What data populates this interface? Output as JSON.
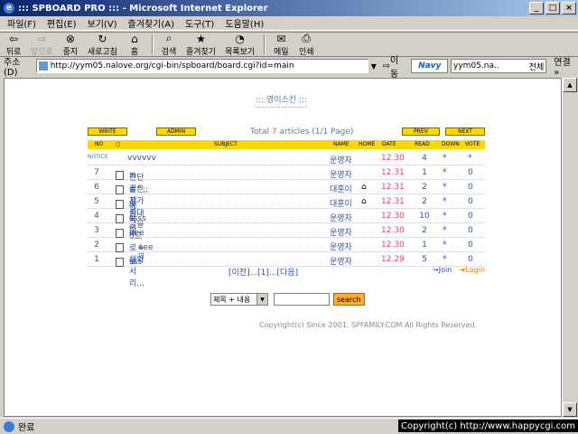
{
  "window": {
    "title": "::: SPBOARD PRO ::: - Microsoft Internet Explorer"
  },
  "menu": [
    "파일(F)",
    "편집(E)",
    "보기(V)",
    "즐겨찾기(A)",
    "도구(T)",
    "도움말(H)"
  ],
  "toolbar": {
    "back": "뒤로",
    "forward": "앞으로",
    "stop": "중지",
    "refresh": "새로고침",
    "home": "홈",
    "search": "검색",
    "favorites": "즐겨찾기",
    "history": "목록보기",
    "mail": "메일",
    "print": "인쇄"
  },
  "address": {
    "label": "주소(D)",
    "url": "http://yym05.nalove.org/cgi-bin/spboard/board.cgi?id=main",
    "go": "이동",
    "search_value": "yym05.na..",
    "search_scope": "전체",
    "links": "연결 »"
  },
  "board": {
    "title": "::: 영이스킨 :::",
    "buttons": {
      "write": "WRITE",
      "admin": "ADMIN",
      "prev": "PREV",
      "next": "NEXT"
    },
    "total_prefix": "Total ",
    "total_num": "7",
    "total_suffix": " articles (1/1 Page)",
    "headers": {
      "no": "NO",
      "subject": "SUBJECT",
      "name": "NAME",
      "home": "HOME",
      "date": "DATE",
      "read": "READ",
      "down": "DOWN",
      "vote": "VOTE"
    },
    "notice": {
      "no": "NOTICE",
      "subject": "vvvvvv",
      "name": "운영자",
      "date": "12.30",
      "read": "4",
      "down": "*",
      "vote": "*"
    },
    "rows": [
      {
        "no": "7",
        "subject": "간단글은 제가 최대글을 0으로 해와서리...",
        "name": "운영자",
        "home": "",
        "date": "12.31",
        "read": "1",
        "down": "*",
        "vote": "0"
      },
      {
        "no": "6",
        "subject": "^^;; 지송..",
        "name": "대훈이",
        "home": "⌂",
        "date": "12.31",
        "read": "2",
        "down": "*",
        "vote": "0"
      },
      {
        "no": "5",
        "subject": "메뉴바..",
        "name": "대훈이",
        "home": "⌂",
        "date": "12.31",
        "read": "2",
        "down": "*",
        "vote": "0"
      },
      {
        "no": "4",
        "subject": "ssss",
        "name": "운영자",
        "home": "",
        "date": "12.30",
        "read": "10",
        "down": "*",
        "vote": "0"
      },
      {
        "no": "3",
        "subject": "eee",
        "name": "운영자",
        "home": "",
        "date": "12.30",
        "read": "2",
        "down": "*",
        "vote": "0"
      },
      {
        "no": "2",
        "subject": "eee",
        "name": "운영자",
        "home": "",
        "date": "12.30",
        "read": "1",
        "down": "*",
        "vote": "0"
      },
      {
        "no": "1",
        "subject": "sss",
        "name": "운영자",
        "home": "",
        "date": "12.29",
        "read": "5",
        "down": "*",
        "vote": "0"
      }
    ],
    "pager": "[이전]...[1]...[다음]",
    "join": "Join",
    "login": "Login",
    "search_select": "제목 + 내용",
    "search_btn": "search",
    "copyright": "Copyright(c) Since 2001, SPFAMILY.COM All Rights Reserved."
  },
  "status": {
    "text": "완료",
    "overlay": "Copyright(c) http://www.happycgi.com"
  }
}
